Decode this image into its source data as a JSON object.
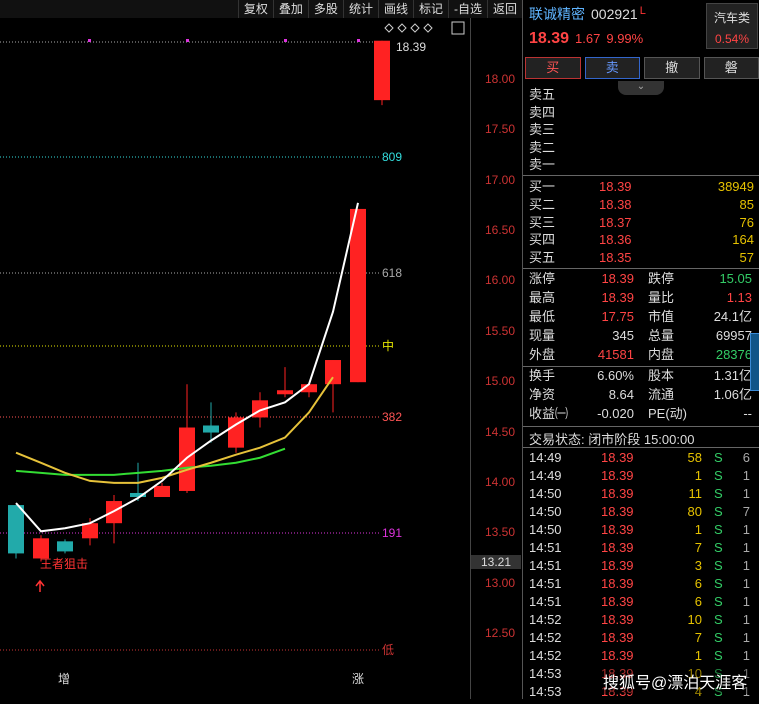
{
  "toolbar": {
    "buttons": [
      "复权",
      "叠加",
      "多股",
      "统计",
      "画线",
      "标记",
      "-自选",
      "返回"
    ]
  },
  "chart": {
    "y_ticks": [
      "18.00",
      "17.50",
      "17.00",
      "16.50",
      "16.00",
      "15.50",
      "15.00",
      "14.50",
      "14.00",
      "13.50",
      "13.00",
      "12.50"
    ],
    "high_label": "18.39",
    "fib_labels": [
      "809",
      "618",
      "中",
      "382",
      "191",
      "低"
    ],
    "annotation": "王者狙击",
    "bottom_marks": [
      "增",
      "涨"
    ],
    "cursor_price": "13.21",
    "colors": {
      "up": "#ff2222",
      "down": "#22aaaa",
      "ma_white": "#ffffff",
      "ma_yellow": "#e6c23a",
      "ma_green": "#33dd33"
    }
  },
  "chart_data": {
    "type": "candlestick",
    "ylim": [
      12.2,
      18.6
    ],
    "candles": [
      {
        "o": 13.78,
        "c": 13.3,
        "h": 13.78,
        "l": 13.25,
        "dir": "down"
      },
      {
        "o": 13.25,
        "c": 13.45,
        "h": 13.48,
        "l": 13.22,
        "dir": "up"
      },
      {
        "o": 13.42,
        "c": 13.32,
        "h": 13.44,
        "l": 13.3,
        "dir": "down"
      },
      {
        "o": 13.45,
        "c": 13.6,
        "h": 13.65,
        "l": 13.38,
        "dir": "up"
      },
      {
        "o": 13.6,
        "c": 13.82,
        "h": 13.88,
        "l": 13.4,
        "dir": "up"
      },
      {
        "o": 13.9,
        "c": 13.86,
        "h": 14.2,
        "l": 13.82,
        "dir": "down"
      },
      {
        "o": 13.86,
        "c": 13.97,
        "h": 14.0,
        "l": 13.86,
        "dir": "up"
      },
      {
        "o": 13.92,
        "c": 14.55,
        "h": 14.98,
        "l": 13.9,
        "dir": "up"
      },
      {
        "o": 14.57,
        "c": 14.5,
        "h": 14.8,
        "l": 14.4,
        "dir": "down"
      },
      {
        "o": 14.35,
        "c": 14.65,
        "h": 14.7,
        "l": 14.3,
        "dir": "up"
      },
      {
        "o": 14.65,
        "c": 14.82,
        "h": 14.9,
        "l": 14.55,
        "dir": "up"
      },
      {
        "o": 14.88,
        "c": 14.92,
        "h": 15.15,
        "l": 14.85,
        "dir": "up"
      },
      {
        "o": 14.9,
        "c": 14.98,
        "h": 15.0,
        "l": 14.85,
        "dir": "up"
      },
      {
        "o": 14.98,
        "c": 15.22,
        "h": 15.22,
        "l": 14.7,
        "dir": "up"
      },
      {
        "o": 15.0,
        "c": 16.72,
        "h": 16.72,
        "l": 15.0,
        "dir": "up"
      },
      {
        "o": 17.8,
        "c": 18.39,
        "h": 18.39,
        "l": 17.75,
        "dir": "up"
      }
    ],
    "ma_white": [
      13.8,
      13.52,
      13.55,
      13.6,
      13.72,
      13.85,
      14.02,
      14.25,
      14.42,
      14.58,
      14.72,
      14.8,
      14.98,
      15.7,
      16.78
    ],
    "ma_yellow": [
      14.3,
      14.2,
      14.1,
      14.02,
      14.0,
      14.0,
      14.05,
      14.13,
      14.2,
      14.28,
      14.35,
      14.45,
      14.7,
      15.05
    ],
    "ma_green": [
      14.12,
      14.1,
      14.08,
      14.08,
      14.08,
      14.1,
      14.12,
      14.15,
      14.17,
      14.2,
      14.25,
      14.34
    ]
  },
  "quote": {
    "name": "联诚精密",
    "code": "002921",
    "mark": "L",
    "sector": "汽车类",
    "sector_pct": "0.54%",
    "price": "18.39",
    "change": "1.67",
    "change_pct": "9.99%",
    "trade_buttons": [
      "买",
      "卖",
      "撤",
      "磐"
    ],
    "collapse_glyph": "⌄",
    "asks": [
      {
        "label": "卖五",
        "price": "",
        "vol": ""
      },
      {
        "label": "卖四",
        "price": "",
        "vol": ""
      },
      {
        "label": "卖三",
        "price": "",
        "vol": ""
      },
      {
        "label": "卖二",
        "price": "",
        "vol": ""
      },
      {
        "label": "卖一",
        "price": "",
        "vol": ""
      }
    ],
    "bids": [
      {
        "label": "买一",
        "price": "18.39",
        "vol": "38949"
      },
      {
        "label": "买二",
        "price": "18.38",
        "vol": "85"
      },
      {
        "label": "买三",
        "price": "18.37",
        "vol": "76"
      },
      {
        "label": "买四",
        "price": "18.36",
        "vol": "164"
      },
      {
        "label": "买五",
        "price": "18.35",
        "vol": "57"
      }
    ],
    "stats": [
      [
        {
          "l": "涨停",
          "v": "18.39",
          "c": "#ff4444"
        },
        {
          "l": "跌停",
          "v": "15.05",
          "c": "#33cc66"
        }
      ],
      [
        {
          "l": "最高",
          "v": "18.39",
          "c": "#ff4444"
        },
        {
          "l": "量比",
          "v": "1.13",
          "c": "#ff4444"
        }
      ],
      [
        {
          "l": "最低",
          "v": "17.75",
          "c": "#ff4444"
        },
        {
          "l": "市值",
          "v": "24.1亿",
          "c": "#ddd"
        }
      ],
      [
        {
          "l": "现量",
          "v": "345",
          "c": "#ddd"
        },
        {
          "l": "总量",
          "v": "69957",
          "c": "#ddd"
        }
      ],
      [
        {
          "l": "外盘",
          "v": "41581",
          "c": "#ff4444"
        },
        {
          "l": "内盘",
          "v": "28376",
          "c": "#33cc66"
        }
      ]
    ],
    "stats2": [
      [
        {
          "l": "换手",
          "v": "6.60%",
          "c": "#ddd"
        },
        {
          "l": "股本",
          "v": "1.31亿",
          "c": "#ddd"
        }
      ],
      [
        {
          "l": "净资",
          "v": "8.64",
          "c": "#ddd"
        },
        {
          "l": "流通",
          "v": "1.06亿",
          "c": "#ddd"
        }
      ],
      [
        {
          "l": "收益㈠",
          "v": "-0.020",
          "c": "#ddd"
        },
        {
          "l": "PE(动)",
          "v": "--",
          "c": "#ddd"
        }
      ]
    ],
    "trade_status": "交易状态: 闭市阶段 15:00:00",
    "trades": [
      {
        "t": "14:49",
        "p": "18.39",
        "v": "58",
        "s": "S",
        "n": "6"
      },
      {
        "t": "14:49",
        "p": "18.39",
        "v": "1",
        "s": "S",
        "n": "1"
      },
      {
        "t": "14:50",
        "p": "18.39",
        "v": "11",
        "s": "S",
        "n": "1"
      },
      {
        "t": "14:50",
        "p": "18.39",
        "v": "80",
        "s": "S",
        "n": "7"
      },
      {
        "t": "14:50",
        "p": "18.39",
        "v": "1",
        "s": "S",
        "n": "1"
      },
      {
        "t": "14:51",
        "p": "18.39",
        "v": "7",
        "s": "S",
        "n": "1"
      },
      {
        "t": "14:51",
        "p": "18.39",
        "v": "3",
        "s": "S",
        "n": "1"
      },
      {
        "t": "14:51",
        "p": "18.39",
        "v": "6",
        "s": "S",
        "n": "1"
      },
      {
        "t": "14:51",
        "p": "18.39",
        "v": "6",
        "s": "S",
        "n": "1"
      },
      {
        "t": "14:52",
        "p": "18.39",
        "v": "10",
        "s": "S",
        "n": "1"
      },
      {
        "t": "14:52",
        "p": "18.39",
        "v": "7",
        "s": "S",
        "n": "1"
      },
      {
        "t": "14:52",
        "p": "18.39",
        "v": "1",
        "s": "S",
        "n": "1"
      },
      {
        "t": "14:53",
        "p": "18.39",
        "v": "10",
        "s": "S",
        "n": "1"
      },
      {
        "t": "14:53",
        "p": "18.39",
        "v": "4",
        "s": "S",
        "n": "1"
      }
    ],
    "watermark": "搜狐号@漂泊天涯客"
  }
}
